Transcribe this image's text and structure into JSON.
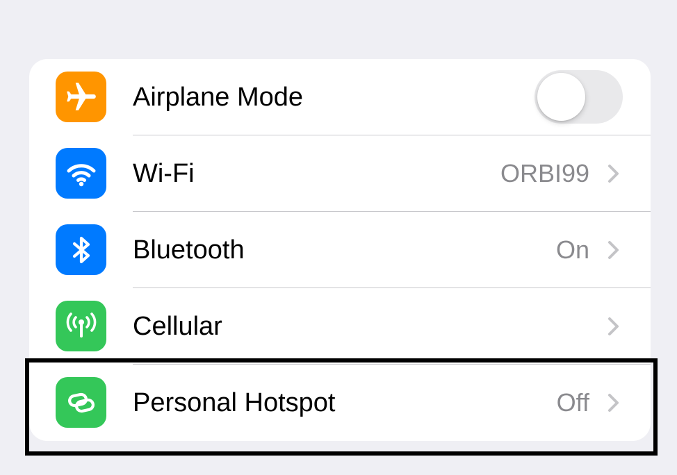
{
  "settings": {
    "rows": [
      {
        "label": "Airplane Mode",
        "icon": "airplane-icon",
        "color": "#ff9500",
        "control": "toggle",
        "toggle_on": false
      },
      {
        "label": "Wi-Fi",
        "value": "ORBI99",
        "icon": "wifi-icon",
        "color": "#007aff",
        "control": "chevron"
      },
      {
        "label": "Bluetooth",
        "value": "On",
        "icon": "bluetooth-icon",
        "color": "#007aff",
        "control": "chevron"
      },
      {
        "label": "Cellular",
        "value": "",
        "icon": "cellular-antenna-icon",
        "color": "#34c759",
        "control": "chevron"
      },
      {
        "label": "Personal Hotspot",
        "value": "Off",
        "icon": "hotspot-link-icon",
        "color": "#34c759",
        "control": "chevron",
        "highlighted": true
      }
    ]
  },
  "colors": {
    "background": "#efeff4",
    "card": "#ffffff",
    "secondary_text": "#8a8a8e",
    "toggle_off_track": "#e9e9eb",
    "highlight_border": "#000000"
  }
}
